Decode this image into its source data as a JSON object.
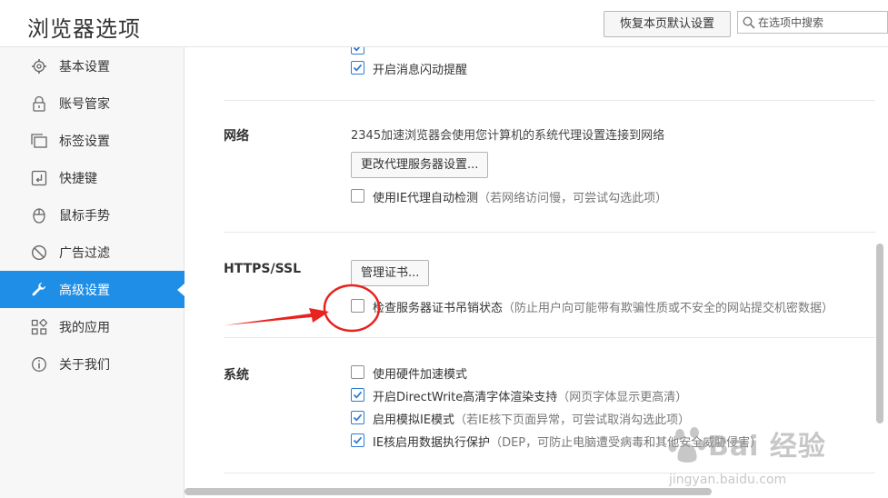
{
  "header": {
    "title": "浏览器选项",
    "reset_button": "恢复本页默认设置",
    "search_placeholder": "在选项中搜索"
  },
  "sidebar": {
    "items": [
      {
        "label": "基本设置",
        "icon": "gear-icon"
      },
      {
        "label": "账号管家",
        "icon": "lock-icon"
      },
      {
        "label": "标签设置",
        "icon": "tabs-icon"
      },
      {
        "label": "快捷键",
        "icon": "keyboard-key-icon"
      },
      {
        "label": "鼠标手势",
        "icon": "mouse-icon"
      },
      {
        "label": "广告过滤",
        "icon": "block-icon"
      },
      {
        "label": "高级设置",
        "icon": "wrench-icon",
        "active": true
      },
      {
        "label": "我的应用",
        "icon": "apps-grid-icon"
      },
      {
        "label": "关于我们",
        "icon": "info-icon"
      }
    ]
  },
  "content": {
    "top_rows": [
      {
        "label": "开启消息闪动提醒",
        "checked": true
      }
    ],
    "network": {
      "label": "网络",
      "description": "2345加速浏览器会使用您计算机的系统代理设置连接到网络",
      "proxy_button": "更改代理服务器设置...",
      "auto_detect": {
        "label": "使用IE代理自动检测",
        "note": "（若网络访问慢，可尝试勾选此项）",
        "checked": false
      }
    },
    "https": {
      "label": "HTTPS/SSL",
      "cert_button": "管理证书...",
      "revocation": {
        "label": "检查服务器证书吊销状态",
        "note": "（防止用户向可能带有欺骗性质或不安全的网站提交机密数据）",
        "checked": false
      }
    },
    "system": {
      "label": "系统",
      "rows": [
        {
          "label": "使用硬件加速模式",
          "note": "",
          "checked": false
        },
        {
          "label": "开启DirectWrite高清字体渲染支持",
          "note": "（网页字体显示更高清）",
          "checked": true
        },
        {
          "label": "启用模拟IE模式",
          "note": "（若IE核下页面异常，可尝试取消勾选此项）",
          "checked": true
        },
        {
          "label": "IE核启用数据执行保护",
          "note": "（DEP，可防止电脑遭受病毒和其他安全威胁侵害）",
          "checked": true
        }
      ]
    }
  },
  "watermark": {
    "brand": "Bai 经验",
    "url": "jingyan.baidu.com"
  },
  "colors": {
    "accent": "#1e8ee6",
    "annotation_red": "#e8231f"
  }
}
